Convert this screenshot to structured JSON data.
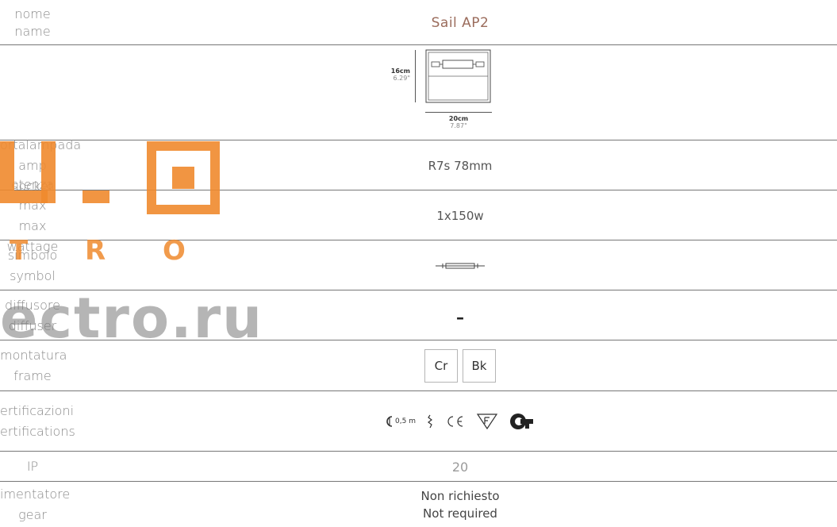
{
  "rows": {
    "name": {
      "label_it": "nome",
      "label_en": "name",
      "value": "Sail AP2"
    },
    "dims": {
      "height_cm": "16cm",
      "height_in": "6.29\"",
      "width_cm": "20cm",
      "width_in": "7.87\""
    },
    "socket": {
      "label_it": "ortalampada",
      "label_en": "amp socket",
      "value": "R7s 78mm"
    },
    "wattage": {
      "label_it": "otenza max",
      "label_en": "max wattage",
      "value": "1x150w"
    },
    "symbol": {
      "label_it": "simbolo",
      "label_en": "symbol"
    },
    "diffuser": {
      "label_it": "diffusore",
      "label_en": "diffuser",
      "value": "–"
    },
    "frame": {
      "label_it": "montatura",
      "label_en": "frame",
      "options": [
        "Cr",
        "Bk"
      ]
    },
    "cert": {
      "label_it": "ertificazioni",
      "label_en": "ertifications",
      "distance": "0,5 m"
    },
    "ip": {
      "label": "IP",
      "value": "20"
    },
    "gear": {
      "label_it": "imentatore",
      "label_en": "gear",
      "value_it": "Non richiesto",
      "value_en": "Not required"
    }
  },
  "watermark": {
    "main": "ectro.ru",
    "sub": "T R O"
  }
}
